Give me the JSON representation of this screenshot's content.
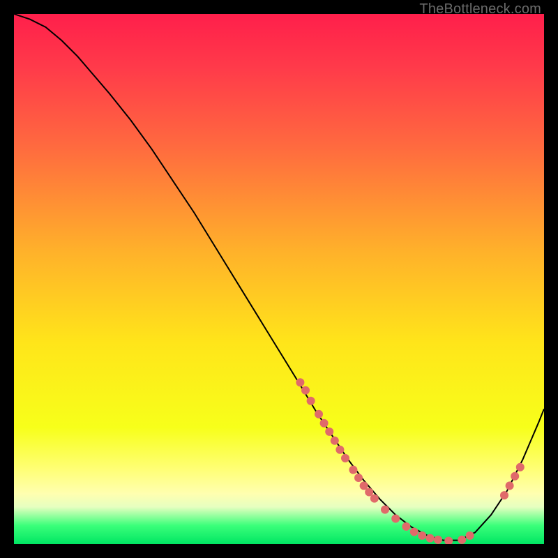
{
  "watermark": "TheBottleneck.com",
  "chart_data": {
    "type": "line",
    "title": "",
    "xlabel": "",
    "ylabel": "",
    "xlim": [
      0,
      100
    ],
    "ylim": [
      0,
      100
    ],
    "grid": false,
    "legend": false,
    "background_gradient": {
      "stops": [
        {
          "offset": 0.0,
          "color": "#ff1f4b"
        },
        {
          "offset": 0.1,
          "color": "#ff3a4a"
        },
        {
          "offset": 0.25,
          "color": "#ff6a3f"
        },
        {
          "offset": 0.45,
          "color": "#ffb22a"
        },
        {
          "offset": 0.62,
          "color": "#ffe51a"
        },
        {
          "offset": 0.78,
          "color": "#f7ff1a"
        },
        {
          "offset": 0.86,
          "color": "#ffff77"
        },
        {
          "offset": 0.905,
          "color": "#ffffb0"
        },
        {
          "offset": 0.93,
          "color": "#e6ffc0"
        },
        {
          "offset": 0.965,
          "color": "#3bff7a"
        },
        {
          "offset": 1.0,
          "color": "#00e663"
        }
      ]
    },
    "series": [
      {
        "name": "curve",
        "color": "#000000",
        "stroke_width": 2,
        "x": [
          0,
          3,
          6,
          9,
          12,
          15,
          18,
          22,
          26,
          30,
          34,
          38,
          42,
          46,
          50,
          54,
          57,
          60,
          63,
          66,
          69,
          72,
          75,
          78,
          81,
          84,
          87,
          90,
          93,
          96,
          99,
          100
        ],
        "y": [
          100,
          99,
          97.5,
          95,
          92,
          88.5,
          85,
          80,
          74.5,
          68.5,
          62.5,
          56,
          49.5,
          43,
          36.5,
          30,
          25,
          20.5,
          16,
          12,
          8.5,
          5.5,
          3.2,
          1.6,
          0.7,
          0.7,
          2.2,
          5.5,
          10,
          16,
          23,
          25.5
        ]
      }
    ],
    "markers": {
      "name": "dots",
      "color": "#e06a6a",
      "radius": 6,
      "points": [
        {
          "x": 54.0,
          "y": 30.5
        },
        {
          "x": 55.0,
          "y": 29.0
        },
        {
          "x": 56.0,
          "y": 27.0
        },
        {
          "x": 57.5,
          "y": 24.5
        },
        {
          "x": 58.5,
          "y": 22.8
        },
        {
          "x": 59.5,
          "y": 21.2
        },
        {
          "x": 60.5,
          "y": 19.5
        },
        {
          "x": 61.5,
          "y": 17.8
        },
        {
          "x": 62.5,
          "y": 16.2
        },
        {
          "x": 64.0,
          "y": 14.0
        },
        {
          "x": 65.0,
          "y": 12.5
        },
        {
          "x": 66.0,
          "y": 11.0
        },
        {
          "x": 67.0,
          "y": 9.8
        },
        {
          "x": 68.0,
          "y": 8.6
        },
        {
          "x": 70.0,
          "y": 6.5
        },
        {
          "x": 72.0,
          "y": 4.8
        },
        {
          "x": 74.0,
          "y": 3.3
        },
        {
          "x": 75.5,
          "y": 2.3
        },
        {
          "x": 77.0,
          "y": 1.6
        },
        {
          "x": 78.5,
          "y": 1.1
        },
        {
          "x": 80.0,
          "y": 0.8
        },
        {
          "x": 82.0,
          "y": 0.6
        },
        {
          "x": 84.5,
          "y": 0.8
        },
        {
          "x": 86.0,
          "y": 1.6
        },
        {
          "x": 92.5,
          "y": 9.2
        },
        {
          "x": 93.5,
          "y": 11.0
        },
        {
          "x": 94.5,
          "y": 12.8
        },
        {
          "x": 95.5,
          "y": 14.5
        }
      ]
    }
  }
}
